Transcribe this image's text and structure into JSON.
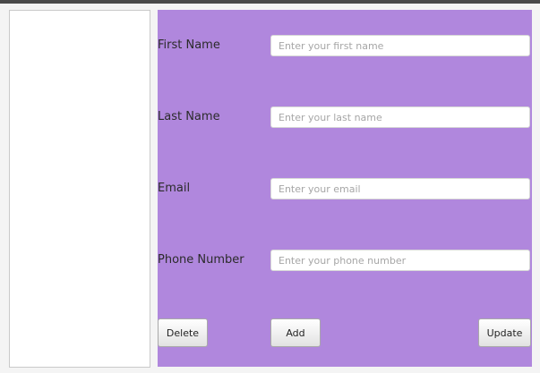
{
  "form": {
    "fields": [
      {
        "label": "First Name",
        "placeholder": "Enter your first name",
        "value": ""
      },
      {
        "label": "Last Name",
        "placeholder": "Enter your last name",
        "value": ""
      },
      {
        "label": "Email",
        "placeholder": "Enter your email",
        "value": ""
      },
      {
        "label": "Phone Number",
        "placeholder": "Enter your phone number",
        "value": ""
      }
    ],
    "buttons": {
      "delete_label": "Delete",
      "add_label": "Add",
      "update_label": "Update"
    }
  },
  "colors": {
    "form_background": "#b087dd",
    "list_background": "#ffffff",
    "window_background": "#f4f4f4"
  }
}
